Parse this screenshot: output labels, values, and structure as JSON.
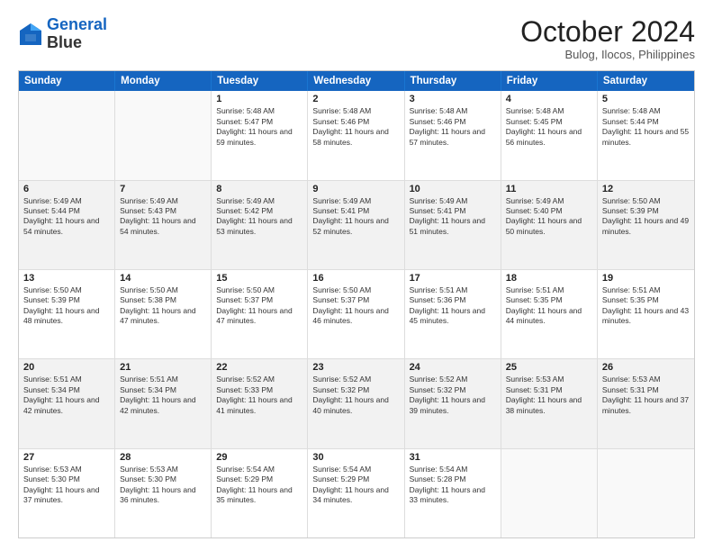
{
  "logo": {
    "line1": "General",
    "line2": "Blue"
  },
  "title": "October 2024",
  "location": "Bulog, Ilocos, Philippines",
  "header_days": [
    "Sunday",
    "Monday",
    "Tuesday",
    "Wednesday",
    "Thursday",
    "Friday",
    "Saturday"
  ],
  "weeks": [
    [
      {
        "day": "",
        "text": ""
      },
      {
        "day": "",
        "text": ""
      },
      {
        "day": "1",
        "text": "Sunrise: 5:48 AM\nSunset: 5:47 PM\nDaylight: 11 hours and 59 minutes."
      },
      {
        "day": "2",
        "text": "Sunrise: 5:48 AM\nSunset: 5:46 PM\nDaylight: 11 hours and 58 minutes."
      },
      {
        "day": "3",
        "text": "Sunrise: 5:48 AM\nSunset: 5:46 PM\nDaylight: 11 hours and 57 minutes."
      },
      {
        "day": "4",
        "text": "Sunrise: 5:48 AM\nSunset: 5:45 PM\nDaylight: 11 hours and 56 minutes."
      },
      {
        "day": "5",
        "text": "Sunrise: 5:48 AM\nSunset: 5:44 PM\nDaylight: 11 hours and 55 minutes."
      }
    ],
    [
      {
        "day": "6",
        "text": "Sunrise: 5:49 AM\nSunset: 5:44 PM\nDaylight: 11 hours and 54 minutes."
      },
      {
        "day": "7",
        "text": "Sunrise: 5:49 AM\nSunset: 5:43 PM\nDaylight: 11 hours and 54 minutes."
      },
      {
        "day": "8",
        "text": "Sunrise: 5:49 AM\nSunset: 5:42 PM\nDaylight: 11 hours and 53 minutes."
      },
      {
        "day": "9",
        "text": "Sunrise: 5:49 AM\nSunset: 5:41 PM\nDaylight: 11 hours and 52 minutes."
      },
      {
        "day": "10",
        "text": "Sunrise: 5:49 AM\nSunset: 5:41 PM\nDaylight: 11 hours and 51 minutes."
      },
      {
        "day": "11",
        "text": "Sunrise: 5:49 AM\nSunset: 5:40 PM\nDaylight: 11 hours and 50 minutes."
      },
      {
        "day": "12",
        "text": "Sunrise: 5:50 AM\nSunset: 5:39 PM\nDaylight: 11 hours and 49 minutes."
      }
    ],
    [
      {
        "day": "13",
        "text": "Sunrise: 5:50 AM\nSunset: 5:39 PM\nDaylight: 11 hours and 48 minutes."
      },
      {
        "day": "14",
        "text": "Sunrise: 5:50 AM\nSunset: 5:38 PM\nDaylight: 11 hours and 47 minutes."
      },
      {
        "day": "15",
        "text": "Sunrise: 5:50 AM\nSunset: 5:37 PM\nDaylight: 11 hours and 47 minutes."
      },
      {
        "day": "16",
        "text": "Sunrise: 5:50 AM\nSunset: 5:37 PM\nDaylight: 11 hours and 46 minutes."
      },
      {
        "day": "17",
        "text": "Sunrise: 5:51 AM\nSunset: 5:36 PM\nDaylight: 11 hours and 45 minutes."
      },
      {
        "day": "18",
        "text": "Sunrise: 5:51 AM\nSunset: 5:35 PM\nDaylight: 11 hours and 44 minutes."
      },
      {
        "day": "19",
        "text": "Sunrise: 5:51 AM\nSunset: 5:35 PM\nDaylight: 11 hours and 43 minutes."
      }
    ],
    [
      {
        "day": "20",
        "text": "Sunrise: 5:51 AM\nSunset: 5:34 PM\nDaylight: 11 hours and 42 minutes."
      },
      {
        "day": "21",
        "text": "Sunrise: 5:51 AM\nSunset: 5:34 PM\nDaylight: 11 hours and 42 minutes."
      },
      {
        "day": "22",
        "text": "Sunrise: 5:52 AM\nSunset: 5:33 PM\nDaylight: 11 hours and 41 minutes."
      },
      {
        "day": "23",
        "text": "Sunrise: 5:52 AM\nSunset: 5:32 PM\nDaylight: 11 hours and 40 minutes."
      },
      {
        "day": "24",
        "text": "Sunrise: 5:52 AM\nSunset: 5:32 PM\nDaylight: 11 hours and 39 minutes."
      },
      {
        "day": "25",
        "text": "Sunrise: 5:53 AM\nSunset: 5:31 PM\nDaylight: 11 hours and 38 minutes."
      },
      {
        "day": "26",
        "text": "Sunrise: 5:53 AM\nSunset: 5:31 PM\nDaylight: 11 hours and 37 minutes."
      }
    ],
    [
      {
        "day": "27",
        "text": "Sunrise: 5:53 AM\nSunset: 5:30 PM\nDaylight: 11 hours and 37 minutes."
      },
      {
        "day": "28",
        "text": "Sunrise: 5:53 AM\nSunset: 5:30 PM\nDaylight: 11 hours and 36 minutes."
      },
      {
        "day": "29",
        "text": "Sunrise: 5:54 AM\nSunset: 5:29 PM\nDaylight: 11 hours and 35 minutes."
      },
      {
        "day": "30",
        "text": "Sunrise: 5:54 AM\nSunset: 5:29 PM\nDaylight: 11 hours and 34 minutes."
      },
      {
        "day": "31",
        "text": "Sunrise: 5:54 AM\nSunset: 5:28 PM\nDaylight: 11 hours and 33 minutes."
      },
      {
        "day": "",
        "text": ""
      },
      {
        "day": "",
        "text": ""
      }
    ]
  ]
}
